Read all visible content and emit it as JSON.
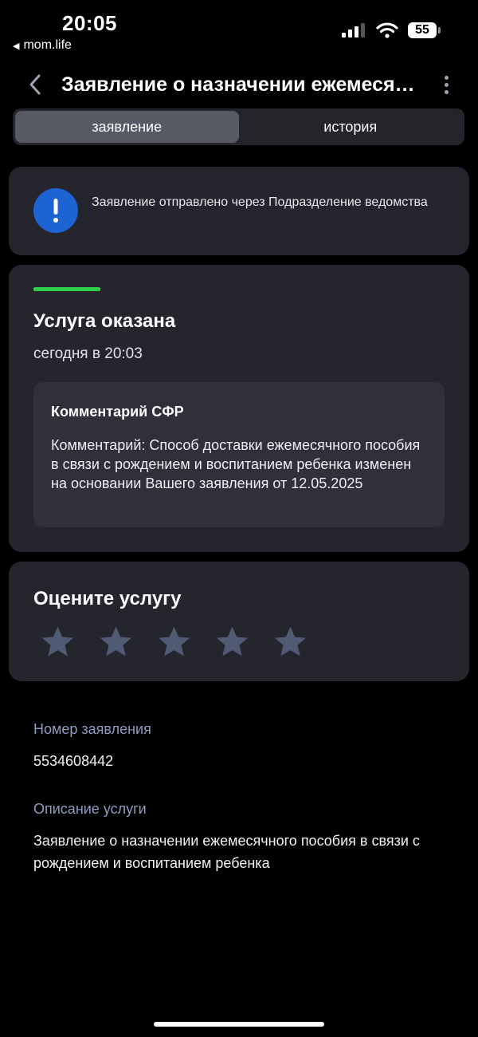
{
  "status_bar": {
    "time": "20:05",
    "back_app": "mom.life",
    "battery": "55"
  },
  "header": {
    "title": "Заявление о назначении ежемесячного пособия в связи с рождением и воспитанием ребенка"
  },
  "tabs": [
    {
      "label": "заявление",
      "active": true
    },
    {
      "label": "история",
      "active": false
    }
  ],
  "notice": {
    "text": "Заявление отправлено через Подразделение ведомства"
  },
  "status": {
    "title": "Услуга оказана",
    "time": "сегодня в 20:03",
    "accent_color": "#2fd14c",
    "comment_title": "Комментарий СФР",
    "comment_text": "Комментарий: Способ доставки ежемесячного пособия в связи с рождением и воспитанием ребенка изменен на основании Вашего заявления от 12.05.2025"
  },
  "rating": {
    "title": "Оцените услугу",
    "stars_total": 5,
    "stars_selected": 0
  },
  "details": {
    "number_label": "Номер заявления",
    "number_value": "5534608442",
    "description_label": "Описание услуги",
    "description_value": "Заявление о назначении ежемесячного пособия в связи с рождением и воспитанием ребенка"
  },
  "icons": {
    "back": "chevron-left-icon",
    "more": "more-vertical-icon",
    "notice": "exclamation-icon",
    "star": "star-icon"
  }
}
